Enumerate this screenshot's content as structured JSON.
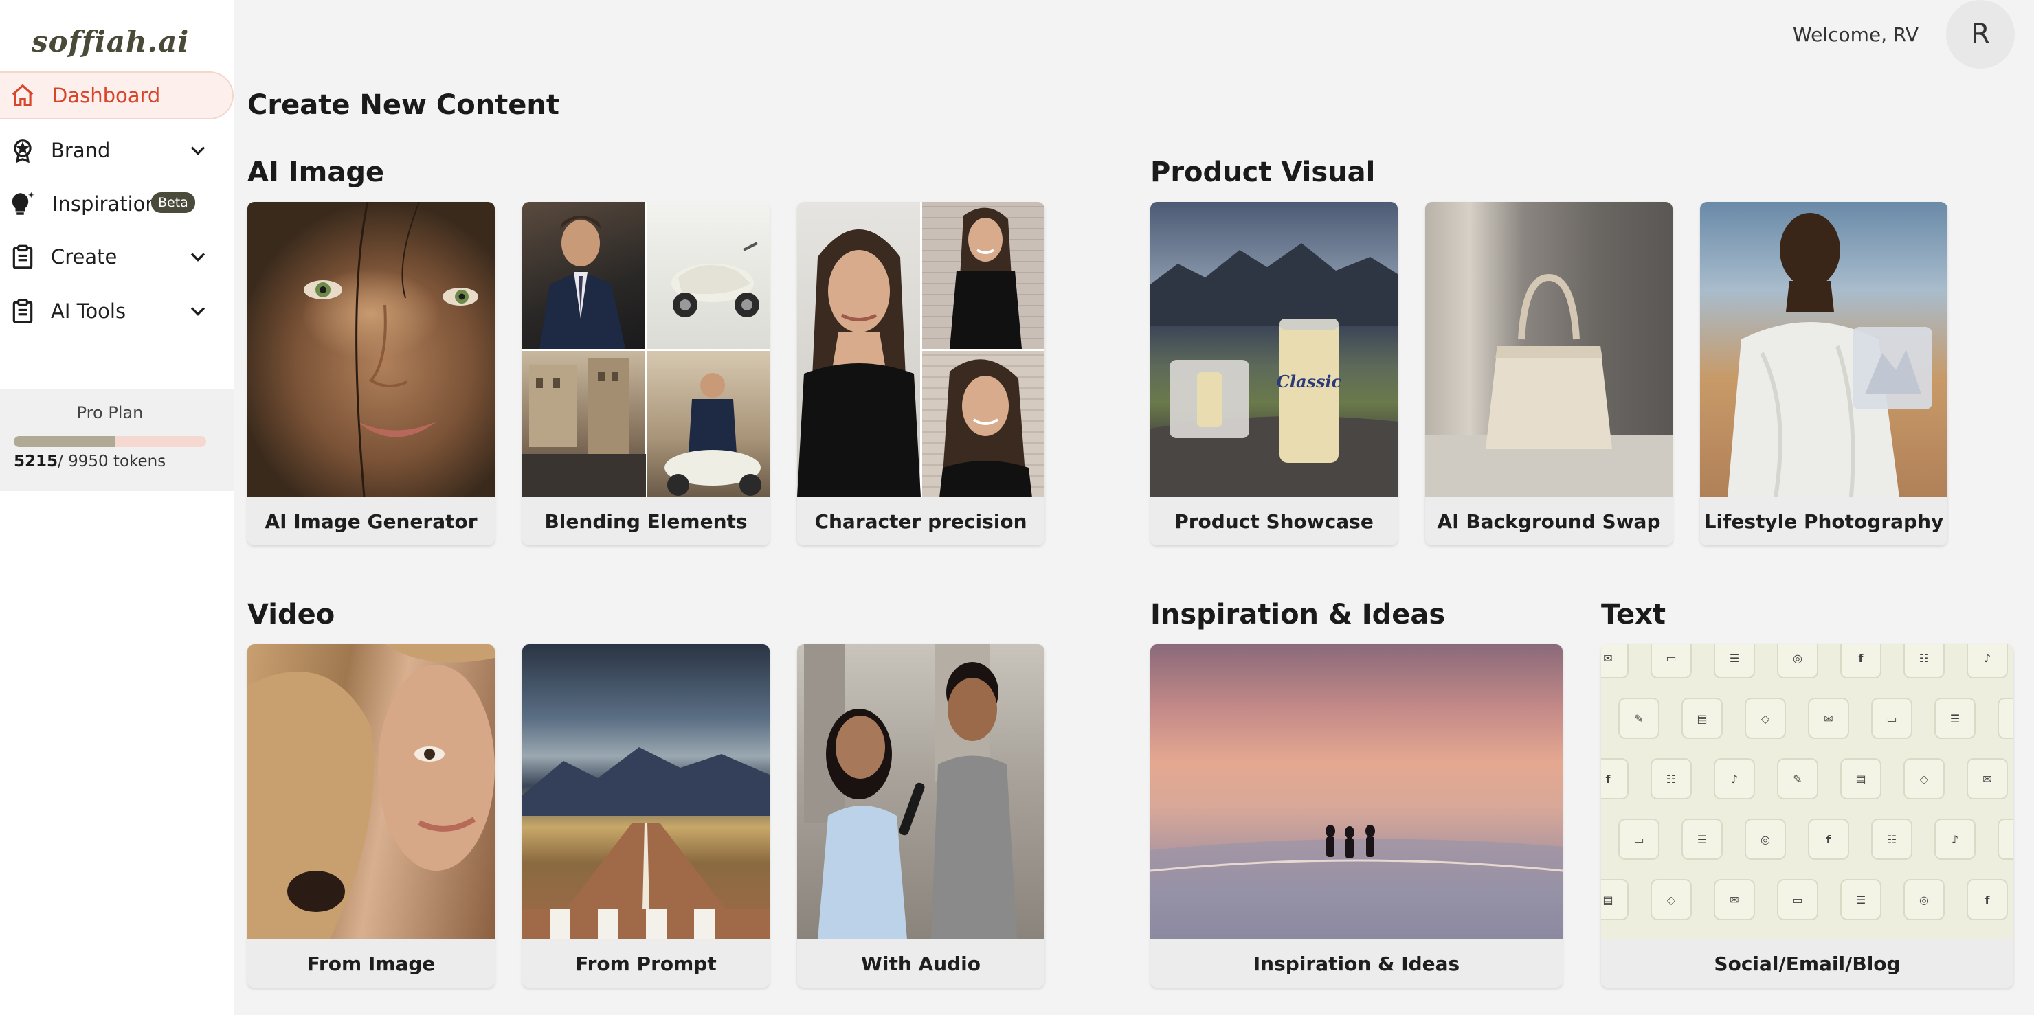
{
  "app": {
    "logo": "soffiah.ai"
  },
  "header": {
    "welcome": "Welcome, RV",
    "avatar_initial": "R"
  },
  "sidebar": {
    "items": [
      {
        "label": "Dashboard",
        "icon": "home-icon",
        "active": true
      },
      {
        "label": "Brand",
        "icon": "badge-icon",
        "expandable": true
      },
      {
        "label": "Inspiration",
        "icon": "lightbulb-icon",
        "badge": "Beta"
      },
      {
        "label": "Create",
        "icon": "clipboard-icon",
        "expandable": true
      },
      {
        "label": "AI Tools",
        "icon": "clipboard-icon",
        "expandable": true
      }
    ],
    "plan": {
      "title": "Pro Plan",
      "used": "5215",
      "total": "/ 9950 tokens",
      "fraction": 0.524
    }
  },
  "main": {
    "title": "Create New Content",
    "sections": {
      "ai_image": {
        "title": "AI Image",
        "cards": [
          "AI Image Generator",
          "Blending Elements",
          "Character precision"
        ]
      },
      "product_visual": {
        "title": "Product Visual",
        "cards": [
          "Product Showcase",
          "AI Background Swap",
          "Lifestyle Photography"
        ]
      },
      "video": {
        "title": "Video",
        "cards": [
          "From Image",
          "From Prompt",
          "With Audio"
        ]
      },
      "inspiration": {
        "title": "Inspiration & Ideas",
        "cards": [
          "Inspiration & Ideas"
        ]
      },
      "text": {
        "title": "Text",
        "cards": [
          "Social/Email/Blog"
        ]
      }
    }
  },
  "colors": {
    "accent": "#d9452b",
    "sidebar_bg": "#ffffff",
    "page_bg": "#f3f3f3"
  }
}
